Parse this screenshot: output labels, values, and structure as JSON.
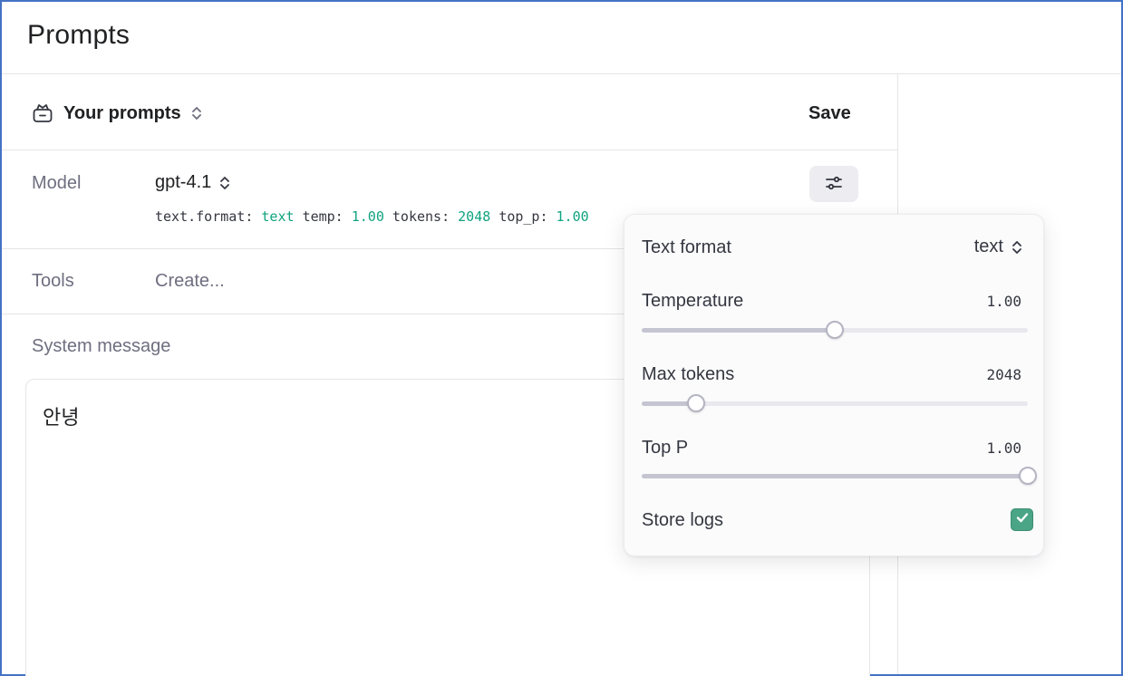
{
  "app": {
    "title": "Prompts"
  },
  "prompts": {
    "label": "Your prompts",
    "save_label": "Save"
  },
  "model": {
    "label": "Model",
    "value": "gpt-4.1",
    "params": [
      {
        "key": "text.format:",
        "value": "text"
      },
      {
        "key": "temp:",
        "value": "1.00"
      },
      {
        "key": "tokens:",
        "value": "2048"
      },
      {
        "key": "top_p:",
        "value": "1.00"
      }
    ]
  },
  "tools": {
    "label": "Tools",
    "value": "Create..."
  },
  "system": {
    "label": "System message",
    "value": "안녕"
  },
  "settings": {
    "text_format": {
      "label": "Text format",
      "value": "text"
    },
    "temperature": {
      "label": "Temperature",
      "value": "1.00",
      "level": 0.5
    },
    "max_tokens": {
      "label": "Max tokens",
      "value": "2048",
      "level": 0.14
    },
    "top_p": {
      "label": "Top P",
      "value": "1.00",
      "level": 1.0
    },
    "store_logs": {
      "label": "Store logs",
      "checked": true
    }
  },
  "colors": {
    "accent": "#10a37f",
    "checkbox": "#4aa586",
    "frame": "#4472c4"
  },
  "icons": [
    "bank-icon",
    "chevron-up-down-icon",
    "sliders-icon",
    "check-icon"
  ]
}
